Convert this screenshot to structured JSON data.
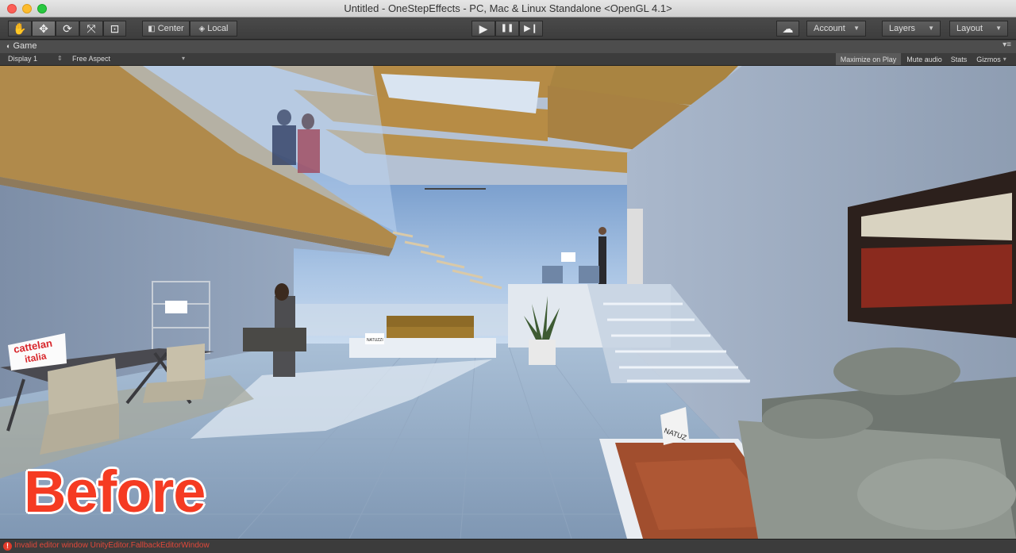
{
  "window": {
    "title": "Untitled - OneStepEffects - PC, Mac & Linux Standalone <OpenGL 4.1>"
  },
  "toolbar": {
    "tools": [
      {
        "name": "hand-tool-icon",
        "glyph": "✋"
      },
      {
        "name": "move-tool-icon",
        "glyph": "✥"
      },
      {
        "name": "rotate-tool-icon",
        "glyph": "⟳"
      },
      {
        "name": "scale-tool-icon",
        "glyph": "⤧"
      },
      {
        "name": "rect-tool-icon",
        "glyph": "⊡"
      }
    ],
    "pivot_center_label": "Center",
    "pivot_local_label": "Local",
    "play_glyph": "▶",
    "pause_glyph": "❚❚",
    "step_glyph": "▶❙",
    "cloud_glyph": "☁",
    "account_label": "Account",
    "layers_label": "Layers",
    "layout_label": "Layout"
  },
  "game_view": {
    "tab_label": "Game",
    "display_label": "Display 1",
    "aspect_label": "Free Aspect",
    "maximize_label": "Maximize on Play",
    "mute_label": "Mute audio",
    "stats_label": "Stats",
    "gizmos_label": "Gizmos"
  },
  "scene": {
    "overlay_text": "Before",
    "signs": {
      "cattelan_line1": "cattelan",
      "cattelan_line2": "italia",
      "natuzzi_small": "NATUZZI",
      "natuzzi_right": "NATUZ"
    }
  },
  "status": {
    "error_message": "Invalid editor window UnityEditor.FallbackEditorWindow"
  },
  "colors": {
    "accent_red": "#f53b22",
    "error_red": "#e2483a",
    "editor_bg": "#3c3c3c"
  }
}
